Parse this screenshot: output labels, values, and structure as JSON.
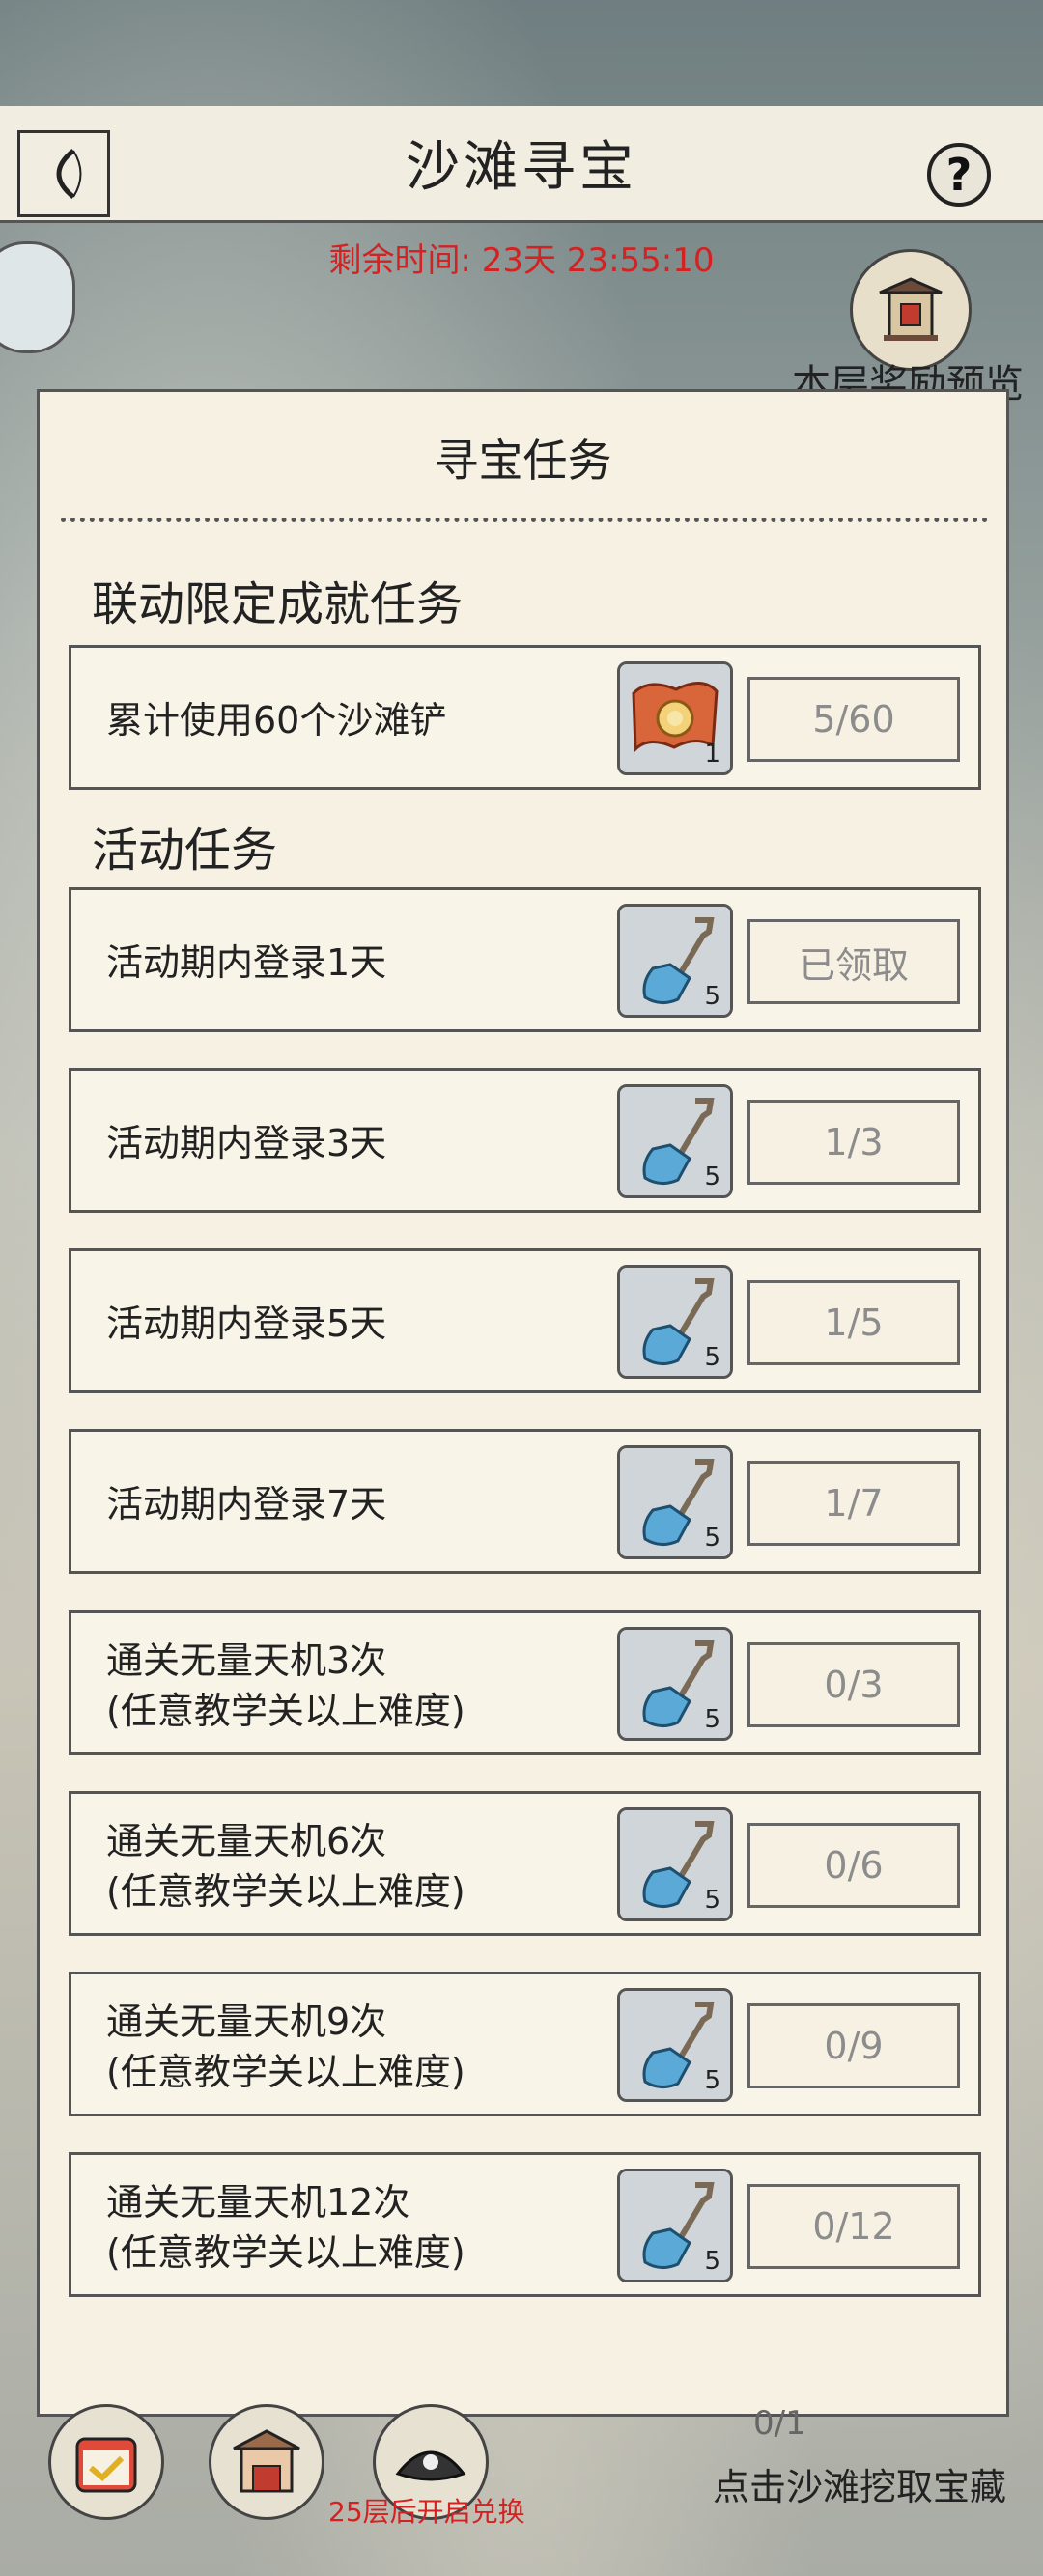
{
  "header": {
    "title": "沙滩寻宝",
    "help_icon": "?"
  },
  "timer": "剩余时间: 23天 23:55:10",
  "reward_preview_label": "本层奖励预览",
  "modal": {
    "title": "寻宝任务",
    "sections": [
      {
        "heading": "联动限定成就任务",
        "tasks": [
          {
            "label": "累计使用60个沙滩铲",
            "reward_icon": "scroll-map-icon",
            "reward_count": "1",
            "progress": "5/60"
          }
        ]
      },
      {
        "heading": "活动任务",
        "tasks": [
          {
            "label": "活动期内登录1天",
            "reward_icon": "shovel-icon",
            "reward_count": "5",
            "progress": "已领取"
          },
          {
            "label": "活动期内登录3天",
            "reward_icon": "shovel-icon",
            "reward_count": "5",
            "progress": "1/3"
          },
          {
            "label": "活动期内登录5天",
            "reward_icon": "shovel-icon",
            "reward_count": "5",
            "progress": "1/5"
          },
          {
            "label": "活动期内登录7天",
            "reward_icon": "shovel-icon",
            "reward_count": "5",
            "progress": "1/7"
          },
          {
            "label": "通关无量天机3次\n(任意教学关以上难度)",
            "reward_icon": "shovel-icon",
            "reward_count": "5",
            "progress": "0/3"
          },
          {
            "label": "通关无量天机6次\n(任意教学关以上难度)",
            "reward_icon": "shovel-icon",
            "reward_count": "5",
            "progress": "0/6"
          },
          {
            "label": "通关无量天机9次\n(任意教学关以上难度)",
            "reward_icon": "shovel-icon",
            "reward_count": "5",
            "progress": "0/9"
          },
          {
            "label": "通关无量天机12次\n(任意教学关以上难度)",
            "reward_icon": "shovel-icon",
            "reward_count": "5",
            "progress": "0/12"
          }
        ]
      }
    ]
  },
  "bottom": {
    "exchange_text": "25层后开启兑换",
    "shovel_count": "0/1",
    "hint": "点击沙滩挖取宝藏"
  },
  "colors": {
    "timer": "#d22222",
    "panel_bg": "#f6f1e3",
    "progress_text": "#8c8c8c",
    "shovel_blue": "#5aa9d6"
  }
}
